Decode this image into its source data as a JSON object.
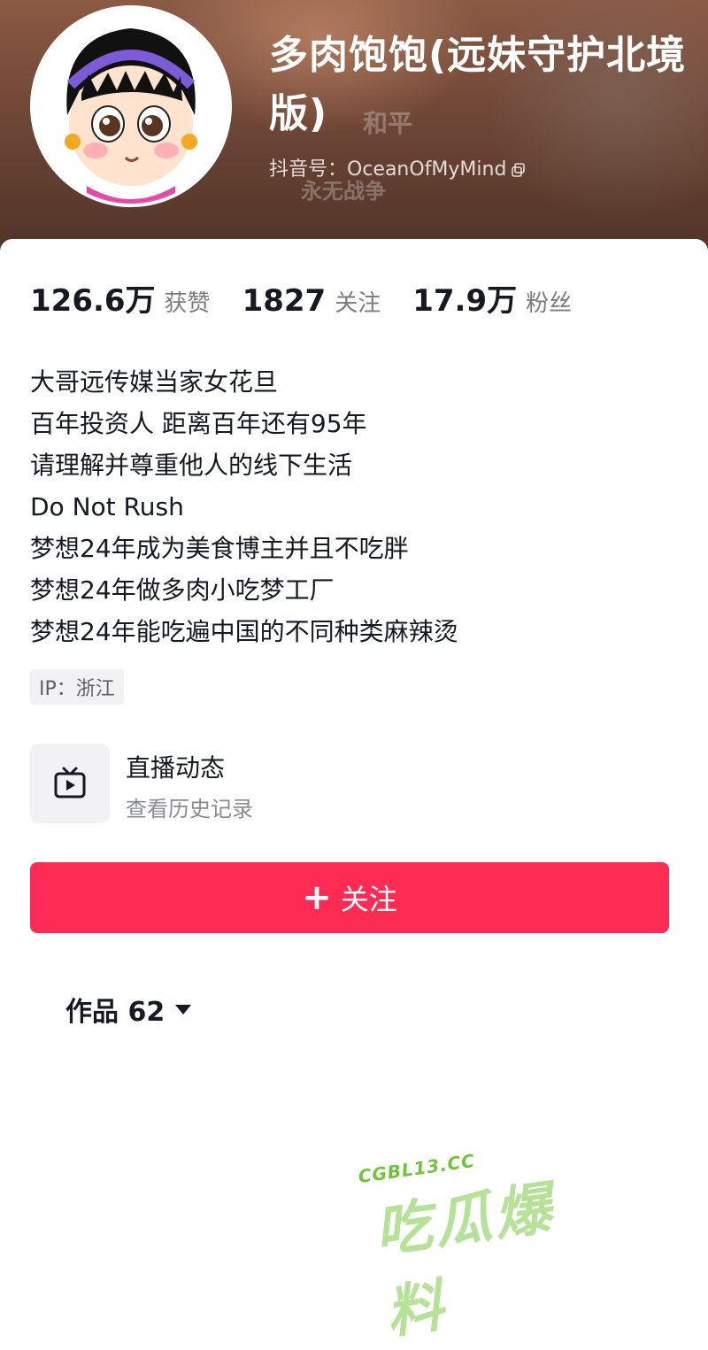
{
  "profile": {
    "name": "多肉饱饱(远妹守护北境版)",
    "douyin_id": "抖音号：OceanOfMyMind",
    "background_text_1": "和平",
    "background_text_2": "永无战争"
  },
  "stats": [
    {
      "value": "126.6万",
      "label": "获赞"
    },
    {
      "value": "1827",
      "label": "关注"
    },
    {
      "value": "17.9万",
      "label": "粉丝"
    }
  ],
  "bio": [
    "大哥远传媒当家女花旦",
    "百年投资人 距离百年还有95年",
    "请理解并尊重他人的线下生活",
    "Do Not Rush",
    "梦想24年成为美食博主并且不吃胖",
    "梦想24年做多肉小吃梦工厂",
    "梦想24年能吃遍中国的不同种类麻辣烫"
  ],
  "ip": "IP：浙江",
  "live": {
    "title": "直播动态",
    "subtitle": "查看历史记录",
    "icon": "tv-icon"
  },
  "follow_button": {
    "plus": "+",
    "label": "关注"
  },
  "works_tab": {
    "label": "作品 62"
  },
  "watermark": {
    "url": "CGBL13.CC",
    "text": "吃瓜爆料"
  },
  "colors": {
    "accent": "#fe2c55",
    "text_primary": "#161823",
    "text_secondary": "#7a7b80",
    "header_bg": "#6e4636"
  }
}
